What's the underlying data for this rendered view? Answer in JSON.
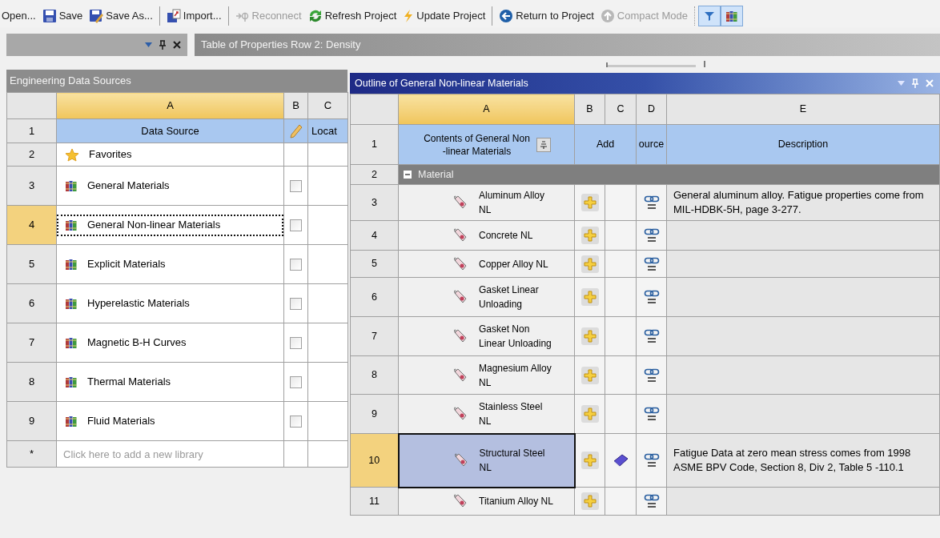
{
  "toolbar": [
    {
      "kind": "button",
      "label": "Open...",
      "disabled": false
    },
    {
      "kind": "button",
      "label": "Save",
      "disabled": false
    },
    {
      "kind": "button",
      "label": "Save As...",
      "disabled": false
    },
    {
      "kind": "separator"
    },
    {
      "kind": "button",
      "label": "Import...",
      "disabled": false
    },
    {
      "kind": "separator"
    },
    {
      "kind": "button",
      "label": "Reconnect",
      "disabled": true
    },
    {
      "kind": "button",
      "label": "Refresh Project",
      "disabled": false
    },
    {
      "kind": "button",
      "label": "Update Project",
      "disabled": false
    },
    {
      "kind": "separator"
    },
    {
      "kind": "button",
      "label": "Return to Project",
      "disabled": false
    },
    {
      "kind": "button",
      "label": "Compact Mode",
      "disabled": true
    },
    {
      "kind": "separator"
    },
    {
      "kind": "toggle",
      "pressed": true
    },
    {
      "kind": "toggle",
      "pressed": true
    }
  ],
  "properties_tab": {
    "title": "Table of Properties Row 2: Density"
  },
  "sources_panel": {
    "title": "Engineering Data Sources",
    "columns": [
      "A",
      "B",
      "C"
    ],
    "header": {
      "num": "1",
      "data_source": "Data Source",
      "location": "Locat"
    },
    "rows": [
      {
        "num": "2",
        "kind": "favorites",
        "label": "Favorites",
        "selected": false
      },
      {
        "num": "3",
        "kind": "library",
        "label": "General Materials",
        "checked": false,
        "selected": false
      },
      {
        "num": "4",
        "kind": "library",
        "label": "General Non-linear Materials",
        "checked": false,
        "selected": true
      },
      {
        "num": "5",
        "kind": "library",
        "label": "Explicit Materials",
        "checked": false,
        "selected": false
      },
      {
        "num": "6",
        "kind": "library",
        "label": "Hyperelastic Materials",
        "checked": false,
        "selected": false
      },
      {
        "num": "7",
        "kind": "library",
        "label": "Magnetic B-H Curves",
        "checked": false,
        "selected": false
      },
      {
        "num": "8",
        "kind": "library",
        "label": "Thermal Materials",
        "checked": false,
        "selected": false
      },
      {
        "num": "9",
        "kind": "library",
        "label": "Fluid Materials",
        "checked": false,
        "selected": false
      }
    ],
    "new_row": {
      "num": "*",
      "placeholder": "Click here to add a new library"
    }
  },
  "outline_panel": {
    "title": "Outline of General Non-linear Materials",
    "columns": [
      "A",
      "B",
      "C",
      "D",
      "E"
    ],
    "header": {
      "num": "1",
      "contents": "Contents of General Non -linear Materials",
      "add": "Add",
      "source": "ource",
      "description": "Description"
    },
    "group": {
      "num": "2",
      "label": "Material",
      "expanded": true
    },
    "rows": [
      {
        "num": "3",
        "name": "Aluminum Alloy NL",
        "description": "General aluminum alloy. Fatigue properties come from MIL-HDBK-5H, page 3-277.",
        "selected": false,
        "column_c_book": false
      },
      {
        "num": "4",
        "name": "Concrete NL",
        "selected": false,
        "column_c_book": false
      },
      {
        "num": "5",
        "name": "Copper Alloy NL",
        "selected": false,
        "column_c_book": false
      },
      {
        "num": "6",
        "name": "Gasket Linear Unloading",
        "selected": false,
        "column_c_book": false
      },
      {
        "num": "7",
        "name": "Gasket Non Linear Unloading",
        "selected": false,
        "column_c_book": false
      },
      {
        "num": "8",
        "name": "Magnesium Alloy NL",
        "selected": false,
        "column_c_book": false
      },
      {
        "num": "9",
        "name": "Stainless Steel NL",
        "selected": false,
        "column_c_book": false
      },
      {
        "num": "10",
        "name": "Structural Steel NL",
        "description": "Fatigue Data at zero mean stress comes from 1998 ASME BPV Code, Section 8, Div 2, Table 5 -110.1",
        "selected": true,
        "column_c_book": true
      },
      {
        "num": "11",
        "name": "Titanium Alloy NL",
        "selected": false,
        "column_c_book": false
      }
    ]
  }
}
